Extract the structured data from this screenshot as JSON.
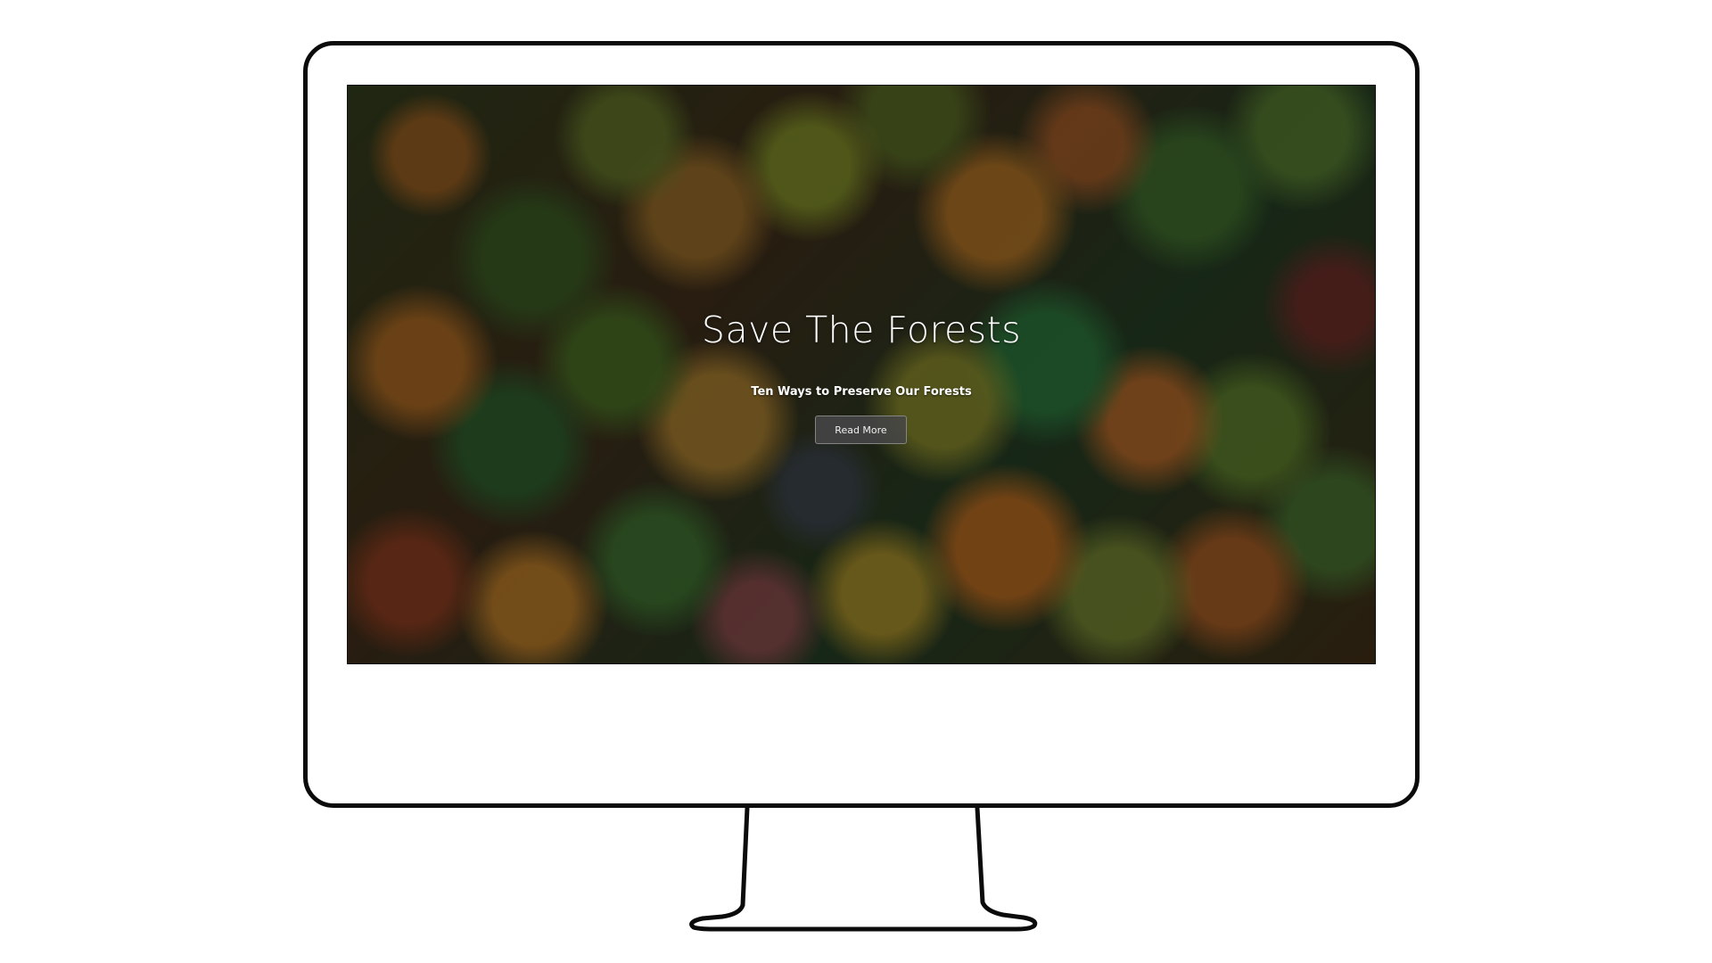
{
  "hero": {
    "title": "Save The Forests",
    "subtitle": "Ten Ways to Preserve Our Forests",
    "button_label": "Read More"
  },
  "colors": {
    "frame": "#0b0b0b",
    "page_background": "#ffffff",
    "button_background": "#464648",
    "text": "#ffffff"
  },
  "background_image": "aerial view of autumn forest canopy"
}
